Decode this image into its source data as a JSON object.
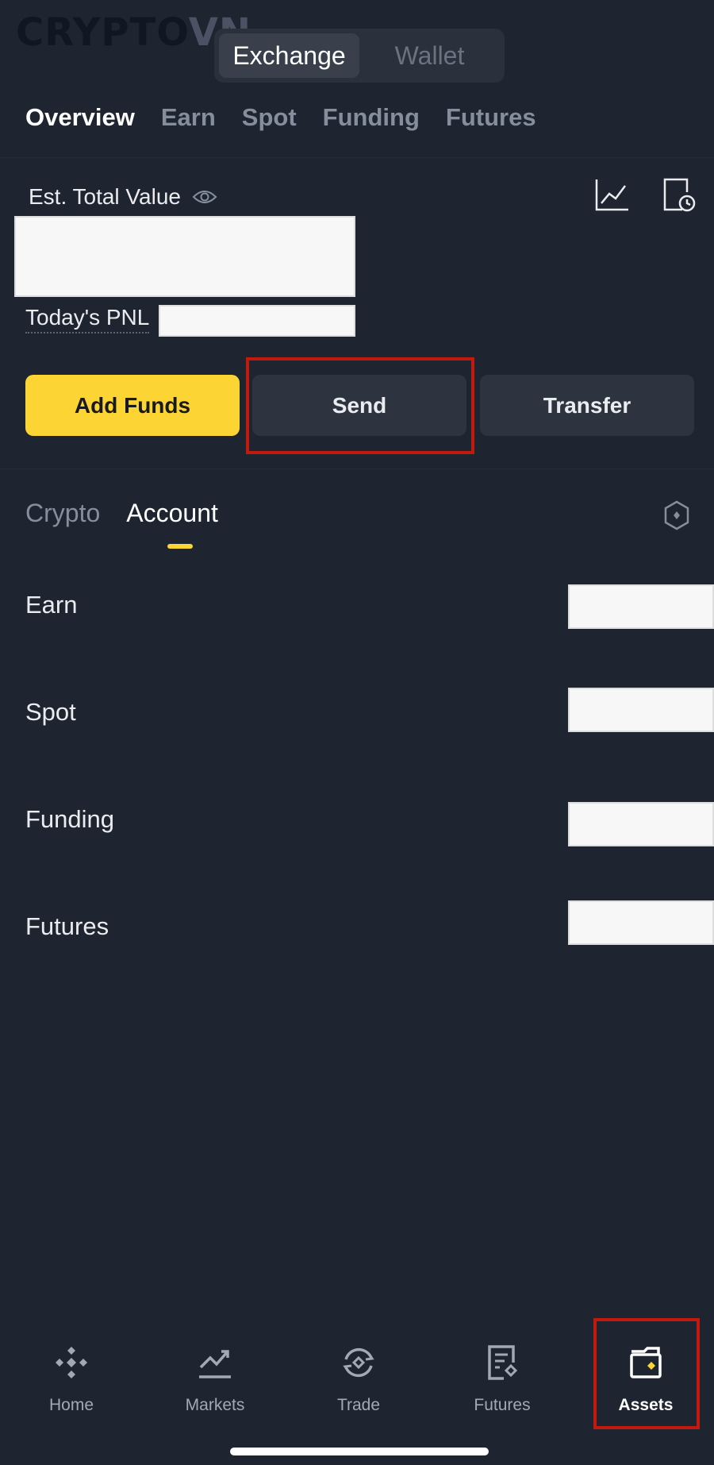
{
  "watermark": {
    "part1": "CRYPTO",
    "part2": "VN"
  },
  "top_switch": {
    "exchange": "Exchange",
    "wallet": "Wallet",
    "selected": "Exchange"
  },
  "category_tabs": [
    "Overview",
    "Earn",
    "Spot",
    "Funding",
    "Futures"
  ],
  "active_category": "Overview",
  "summary": {
    "est_label": "Est. Total Value",
    "pnl_label": "Today's PNL"
  },
  "actions": {
    "add_funds": "Add Funds",
    "send": "Send",
    "transfer": "Transfer"
  },
  "sub_tabs": {
    "crypto": "Crypto",
    "account": "Account",
    "selected": "Account"
  },
  "accounts": [
    "Earn",
    "Spot",
    "Funding",
    "Futures"
  ],
  "bottom_nav": {
    "home": "Home",
    "markets": "Markets",
    "trade": "Trade",
    "futures": "Futures",
    "assets": "Assets",
    "selected": "Assets"
  },
  "icons": [
    "eye-icon",
    "chart-icon",
    "history-icon",
    "settings-hex-icon",
    "home-icon",
    "markets-icon",
    "trade-icon",
    "futures-icon",
    "assets-icon"
  ],
  "colors": {
    "background": "#1f2530",
    "accent": "#fcd535",
    "highlight": "#c1190c",
    "button": "#2e343f"
  }
}
